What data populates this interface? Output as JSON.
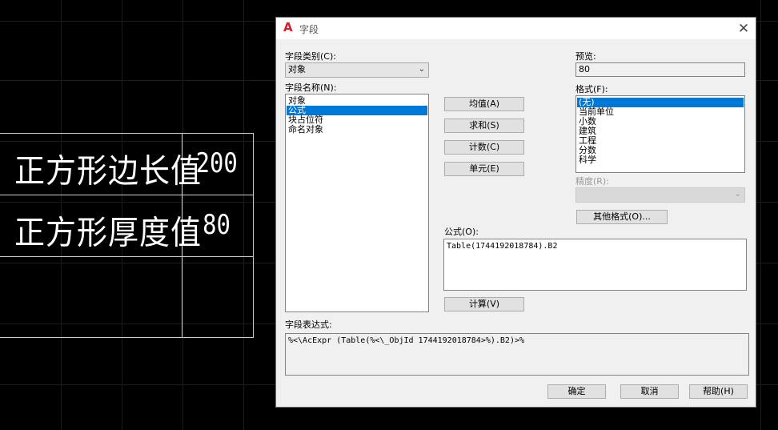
{
  "cad": {
    "rows": [
      {
        "label": "正方形边长值",
        "value": "200"
      },
      {
        "label": "正方形厚度值",
        "value": "80"
      },
      {
        "label": "",
        "value": ""
      }
    ]
  },
  "dialog": {
    "title": "字段",
    "close_label": "✕",
    "field_category_label": "字段类别(C):",
    "field_category_value": "对象",
    "field_names_label": "字段名称(N):",
    "field_names": [
      "对象",
      "公式",
      "块占位符",
      "命名对象"
    ],
    "field_names_selected": 1,
    "buttons": {
      "average": "均值(A)",
      "sum": "求和(S)",
      "count": "计数(C)",
      "cell": "单元(E)",
      "evaluate": "计算(V)",
      "other_format": "其他格式(O)...",
      "ok": "确定",
      "cancel": "取消",
      "help": "帮助(H)"
    },
    "preview_label": "预览:",
    "preview_value": "80",
    "format_label": "格式(F):",
    "formats": [
      "(无)",
      "当前单位",
      "小数",
      "建筑",
      "工程",
      "分数",
      "科学"
    ],
    "formats_selected": 0,
    "precision_label": "精度(R):",
    "precision_value": "",
    "formula_label": "公式(O):",
    "formula_value": "Table(1744192018784).B2",
    "expression_label": "字段表达式:",
    "expression_value": "%<\\AcExpr (Table(%<\\_ObjId 1744192018784>%).B2)>%",
    "dropdown_arrow": "⌄"
  },
  "colors": {
    "selection": "#0078d7",
    "background": "#000000",
    "dialog_bg": "#f0f0f0"
  }
}
